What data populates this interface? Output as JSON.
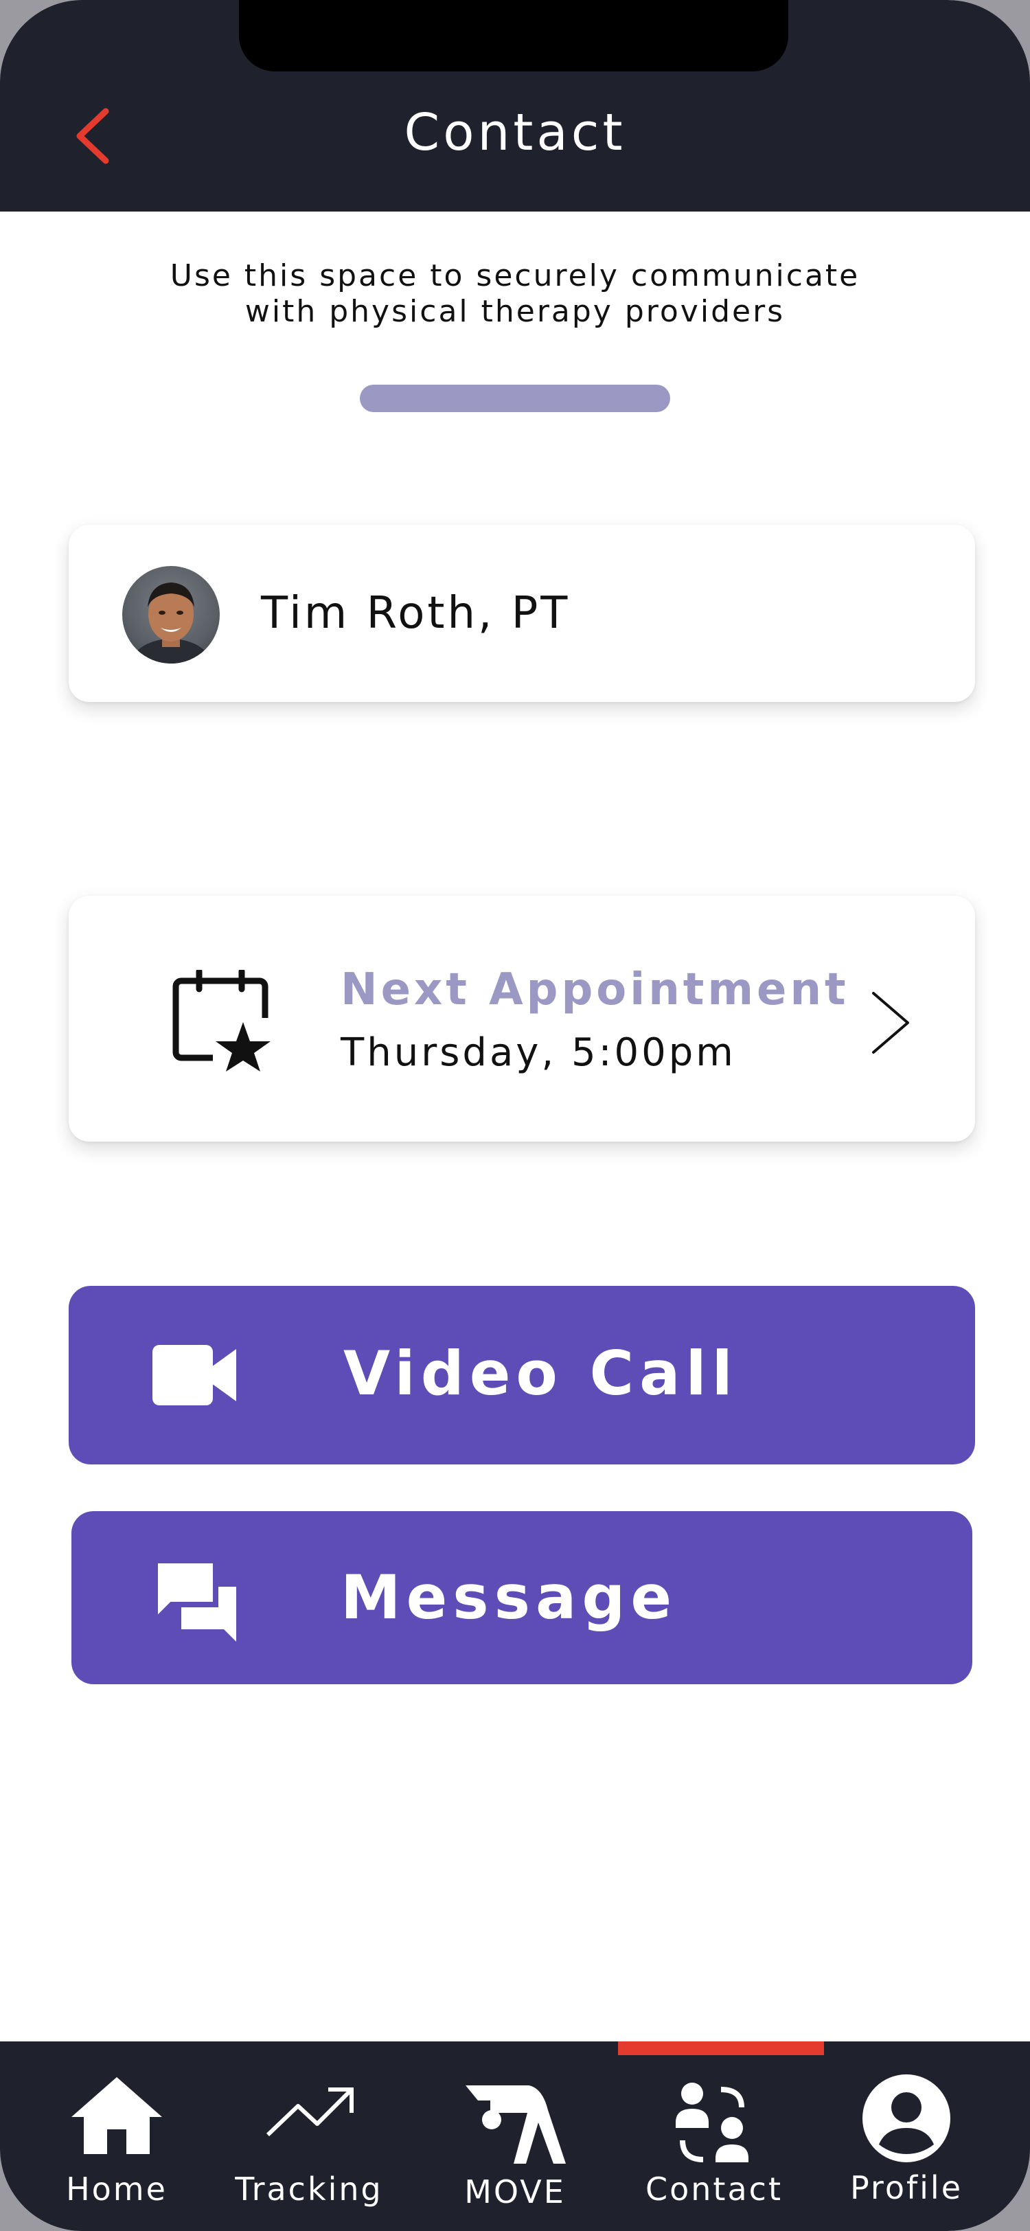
{
  "header": {
    "title": "Contact"
  },
  "intro": {
    "line1": "Use this space to securely communicate",
    "line2": "with physical therapy providers"
  },
  "provider": {
    "name": "Tim Roth, PT"
  },
  "appointment": {
    "label": "Next Appointment",
    "time": "Thursday, 5:00pm"
  },
  "actions": {
    "video_call": "Video Call",
    "message": "Message"
  },
  "nav": {
    "items": [
      {
        "label": "Home",
        "icon": "home-icon"
      },
      {
        "label": "Tracking",
        "icon": "trending-up-icon"
      },
      {
        "label": "MOVE",
        "icon": "stretch-figure-icon"
      },
      {
        "label": "Contact",
        "icon": "contacts-icon"
      },
      {
        "label": "Profile",
        "icon": "user-circle-icon"
      }
    ],
    "active": "Contact"
  },
  "colors": {
    "header_bg": "#1f212d",
    "accent_red": "#e53b2f",
    "primary_purple": "#5e4db6",
    "muted_purple": "#9b99c4"
  }
}
